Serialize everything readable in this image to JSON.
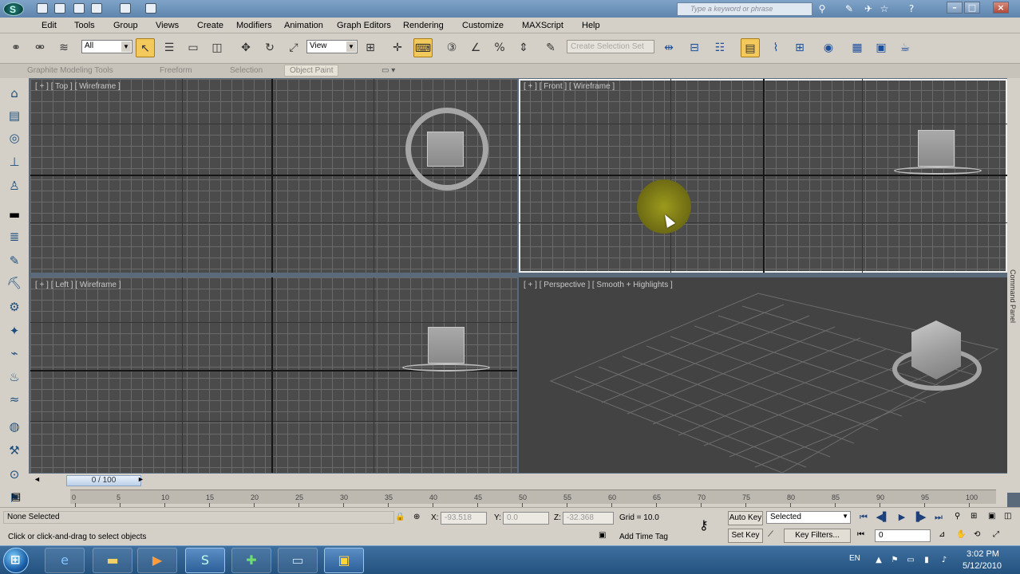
{
  "titlebar": {
    "search_placeholder": "Type a keyword or phrase"
  },
  "menu": [
    "Edit",
    "Tools",
    "Group",
    "Views",
    "Create",
    "Modifiers",
    "Animation",
    "Graph Editors",
    "Rendering",
    "Customize",
    "MAXScript",
    "Help"
  ],
  "toolbar": {
    "selection_filter": "All",
    "reference_coord": "View",
    "named_selection_placeholder": "Create Selection Set"
  },
  "ribbon": {
    "tabs": [
      "Graphite Modeling Tools",
      "Freeform",
      "Selection",
      "Object Paint"
    ]
  },
  "viewports": {
    "top": {
      "label": "[ + ] [ Top ] [ Wireframe ]"
    },
    "front": {
      "label": "[ + ] [ Front ] [ Wireframe ]"
    },
    "left": {
      "label": "[ + ] [ Left ] [ Wireframe ]"
    },
    "perspective": {
      "label": "[ + ] [ Perspective ] [ Smooth + Highlights ]"
    }
  },
  "command_panel_label": "Command Panel",
  "timeline": {
    "position": "0 / 100",
    "ticks": [
      "0",
      "5",
      "10",
      "15",
      "20",
      "25",
      "30",
      "35",
      "40",
      "45",
      "50",
      "55",
      "60",
      "65",
      "70",
      "75",
      "80",
      "85",
      "90",
      "95",
      "100"
    ]
  },
  "status": {
    "selection": "None Selected",
    "prompt": "Click or click-and-drag to select objects",
    "x_label": "X:",
    "x_value": "-93.518",
    "y_label": "Y:",
    "y_value": "0.0",
    "z_label": "Z:",
    "z_value": "-32.368",
    "grid": "Grid = 10.0",
    "add_time_tag": "Add Time Tag",
    "auto_key": "Auto Key",
    "set_key": "Set Key",
    "key_mode": "Selected",
    "key_filters": "Key Filters...",
    "current_frame": "0"
  },
  "taskbar": {
    "language": "EN",
    "time": "3:02 PM",
    "date": "5/12/2010"
  }
}
